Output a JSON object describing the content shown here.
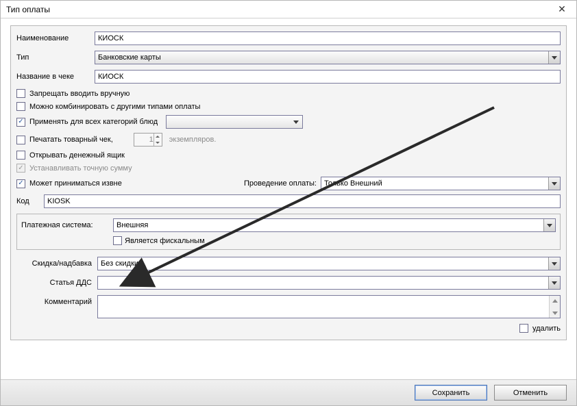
{
  "window": {
    "title": "Тип оплаты"
  },
  "labels": {
    "name": "Наименование",
    "type": "Тип",
    "name_in_check": "Название в чеке",
    "code": "Код",
    "payment_system": "Платежная система:",
    "discount": "Скидка/надбавка",
    "dds": "Статья ДДС",
    "comment": "Комментарий",
    "payment_mode": "Проведение оплаты:"
  },
  "fields": {
    "name": "КИОСК",
    "type": "Банковские карты",
    "name_in_check": "КИОСК",
    "category_select": "",
    "copies": "1",
    "copies_suffix": "экземпляров.",
    "payment_mode": "Только Внешний",
    "code": "KIOSK",
    "payment_system": "Внешняя",
    "discount": "Без скидки",
    "dds": "",
    "comment": ""
  },
  "checkboxes": {
    "forbid_manual": {
      "label": "Запрещать вводить вручную",
      "checked": false
    },
    "combinable": {
      "label": "Можно комбинировать с другими типами оплаты",
      "checked": false
    },
    "all_categories": {
      "label": "Применять для всех категорий блюд",
      "checked": true
    },
    "print_receipt_prefix": {
      "label": "Печатать товарный чек,",
      "checked": false
    },
    "open_drawer": {
      "label": "Открывать денежный ящик",
      "checked": false
    },
    "exact_amount": {
      "label": "Устанавливать точную сумму",
      "checked": true,
      "disabled": true
    },
    "accept_external": {
      "label": "Может приниматься извне",
      "checked": true
    },
    "is_fiscal": {
      "label": "Является фискальным",
      "checked": false
    },
    "delete": {
      "label": "удалить",
      "checked": false
    }
  },
  "buttons": {
    "save": "Сохранить",
    "cancel": "Отменить"
  }
}
